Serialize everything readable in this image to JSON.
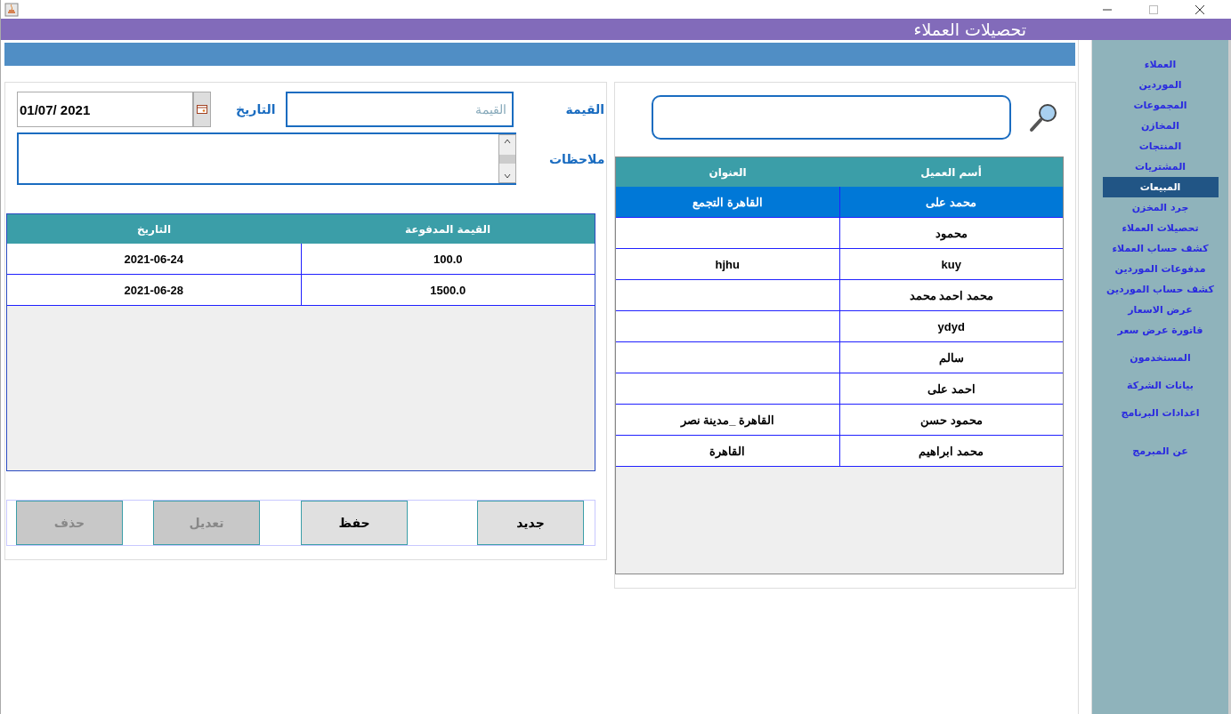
{
  "window": {
    "title": "تحصيلات العملاء"
  },
  "form": {
    "amount_label": "القيمة",
    "amount_placeholder": "القيمة",
    "date_label": "التاريخ",
    "date_value": "01/07/ 2021",
    "notes_label": "ملاحظات"
  },
  "payments_table": {
    "columns": [
      "القيمة المدفوعة",
      "التاريخ"
    ],
    "rows": [
      {
        "cells": [
          "100.0",
          "2021-06-24"
        ]
      },
      {
        "cells": [
          "1500.0",
          "2021-06-28"
        ]
      }
    ]
  },
  "buttons": [
    {
      "label": "جديد",
      "disabled": false
    },
    {
      "label": "حفظ",
      "disabled": false
    },
    {
      "label": "تعديل",
      "disabled": true
    },
    {
      "label": "حذف",
      "disabled": true
    }
  ],
  "customers_table": {
    "columns": [
      "أسم العميل",
      "العنوان"
    ],
    "rows": [
      {
        "cells": [
          "محمد على",
          "القاهرة التجمع"
        ],
        "selected": true
      },
      {
        "cells": [
          "محمود",
          ""
        ],
        "selected": false
      },
      {
        "cells": [
          "kuy",
          "hjhu"
        ],
        "selected": false
      },
      {
        "cells": [
          "محمد احمد محمد",
          ""
        ],
        "selected": false
      },
      {
        "cells": [
          "ydyd",
          ""
        ],
        "selected": false
      },
      {
        "cells": [
          "سالم",
          ""
        ],
        "selected": false
      },
      {
        "cells": [
          "احمد على",
          ""
        ],
        "selected": false
      },
      {
        "cells": [
          "محمود حسن",
          "القاهرة _مدينة نصر"
        ],
        "selected": false
      },
      {
        "cells": [
          "محمد ابراهيم",
          "القاهرة"
        ],
        "selected": false
      }
    ]
  },
  "sidebar": {
    "items": [
      {
        "label": "العملاء",
        "selected": false
      },
      {
        "label": "الموردين",
        "selected": false
      },
      {
        "label": "المجموعات",
        "selected": false
      },
      {
        "label": "المخازن",
        "selected": false
      },
      {
        "label": "المنتجات",
        "selected": false
      },
      {
        "label": "المشتريات",
        "selected": false
      },
      {
        "label": "المبيعات",
        "selected": true
      },
      {
        "label": "جرد المخزن",
        "selected": false
      },
      {
        "label": "تحصيلات العملاء",
        "selected": false
      },
      {
        "label": "كشف حساب العملاء",
        "selected": false
      },
      {
        "label": "مدفوعات  الموردين",
        "selected": false
      },
      {
        "label": "كشف حساب  الموردين",
        "selected": false
      },
      {
        "label": "عرض الاسعار",
        "selected": false
      },
      {
        "label": "فاتورة عرض سعر",
        "selected": false
      },
      {
        "label": "المستخدمون",
        "selected": false
      },
      {
        "label": "بيانات الشركة",
        "selected": false
      },
      {
        "label": "اعدادات البرنامج",
        "selected": false
      },
      {
        "label": "عن المبرمج",
        "selected": false
      }
    ]
  }
}
